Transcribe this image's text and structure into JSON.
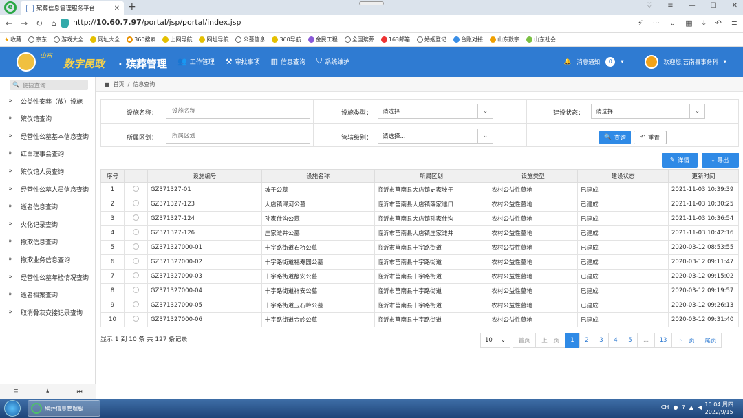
{
  "browser": {
    "tab_title": "殡葬信息管理服务平台",
    "url_prefix": "http://",
    "url_host": "10.60.7.97",
    "url_path": "/portal/jsp/portal/index.jsp"
  },
  "bookmarks": [
    "收藏",
    "京东",
    "游戏大全",
    "网址大全",
    "360搜索",
    "上网导航",
    "网址导航",
    "公墓信息",
    "360导航",
    "金民工程",
    "全国殡葬",
    "163邮箱",
    "婚姻登记",
    "台账对接",
    "山东数字",
    "山东社会"
  ],
  "header": {
    "brand_small": "山东",
    "brand_main": "数字民政",
    "brand_sub": "· 殡葬管理",
    "nav": [
      {
        "label": "工作管理",
        "icon": "users-icon"
      },
      {
        "label": "审批事项",
        "icon": "gavel-icon"
      },
      {
        "label": "信息查询",
        "icon": "chart-icon"
      },
      {
        "label": "系统维护",
        "icon": "shield-icon"
      }
    ],
    "notify_label": "消息通知",
    "notify_count": "0",
    "welcome": "欢迎您,莒南县事务科"
  },
  "sidebar": {
    "search_placeholder": "便捷查询",
    "items": [
      "公益性安葬（放）设施",
      "殡仪馆查询",
      "经营性公墓基本信息查询",
      "红白理事会查询",
      "殡仪馆人员查询",
      "经营性公墓人员信息查询",
      "逝者信息查询",
      "火化记录查询",
      "撤欺信息查询",
      "撤欺业务信息查询",
      "经营性公墓年检情况查询",
      "逝者档案查询",
      "取消骨灰交接记录查询"
    ]
  },
  "breadcrumb": {
    "home": "首页",
    "sep": "/",
    "current": "信息查询"
  },
  "filter": {
    "facility_name_label": "设施名称：",
    "facility_name_placeholder": "设施名称",
    "facility_type_label": "设施类型：",
    "facility_type_value": "请选择",
    "build_status_label": "建设状态：",
    "build_status_value": "请选择",
    "region_label": "所属区划：",
    "region_placeholder": "所属区划",
    "level_label": "管辖级别：",
    "level_value": "请选择...",
    "query_btn": "查询",
    "reset_btn": "重置"
  },
  "actions": {
    "detail": "详情",
    "export": "导出"
  },
  "table": {
    "headers": [
      "序号",
      "",
      "设施编号",
      "设施名称",
      "所属区划",
      "设施类型",
      "建设状态",
      "更新时间"
    ],
    "rows": [
      [
        "1",
        "GZ371327-01",
        "坡子公墓",
        "临沂市莒南县大店镇史家坡子",
        "农村公益性墓地",
        "已建成",
        "2021-11-03 10:39:39"
      ],
      [
        "2",
        "GZ371327-123",
        "大店镇浔河公墓",
        "临沂市莒南县大店镇薛家邋口",
        "农村公益性墓地",
        "已建成",
        "2021-11-03 10:30:25"
      ],
      [
        "3",
        "GZ371327-124",
        "孙家仕沟公墓",
        "临沂市莒南县大店镇孙家仕沟",
        "农村公益性墓地",
        "已建成",
        "2021-11-03 10:36:54"
      ],
      [
        "4",
        "GZ371327-126",
        "庄家滩井公墓",
        "临沂市莒南县大店镇庄家滩井",
        "农村公益性墓地",
        "已建成",
        "2021-11-03 10:42:16"
      ],
      [
        "5",
        "GZ371327000-01",
        "十字路街道石桥公墓",
        "临沂市莒南县十字路街道",
        "农村公益性墓地",
        "已建成",
        "2020-03-12 08:53:55"
      ],
      [
        "6",
        "GZ371327000-02",
        "十字路街道福寿园公墓",
        "临沂市莒南县十字路街道",
        "农村公益性墓地",
        "已建成",
        "2020-03-12 09:11:47"
      ],
      [
        "7",
        "GZ371327000-03",
        "十字路街道静安公墓",
        "临沂市莒南县十字路街道",
        "农村公益性墓地",
        "已建成",
        "2020-03-12 09:15:02"
      ],
      [
        "8",
        "GZ371327000-04",
        "十字路街道祥安公墓",
        "临沂市莒南县十字路街道",
        "农村公益性墓地",
        "已建成",
        "2020-03-12 09:19:57"
      ],
      [
        "9",
        "GZ371327000-05",
        "十字路街道玉石岭公墓",
        "临沂市莒南县十字路街道",
        "农村公益性墓地",
        "已建成",
        "2020-03-12 09:26:13"
      ],
      [
        "10",
        "GZ371327000-06",
        "十字路街道金岭公墓",
        "临沂市莒南县十字路街道",
        "农村公益性墓地",
        "已建成",
        "2020-03-12 09:31:40"
      ]
    ]
  },
  "footer": {
    "summary": "显示 1 到 10 条 共 127 条记录",
    "page_size": "10",
    "pages": [
      "首页",
      "上一页",
      "1",
      "2",
      "3",
      "4",
      "5",
      "...",
      "13",
      "下一页",
      "尾页"
    ]
  },
  "taskbar": {
    "app_label": "殡葬信息管理服...",
    "time": "10:04 周四",
    "date": "2022/9/15",
    "tray": "CH"
  }
}
